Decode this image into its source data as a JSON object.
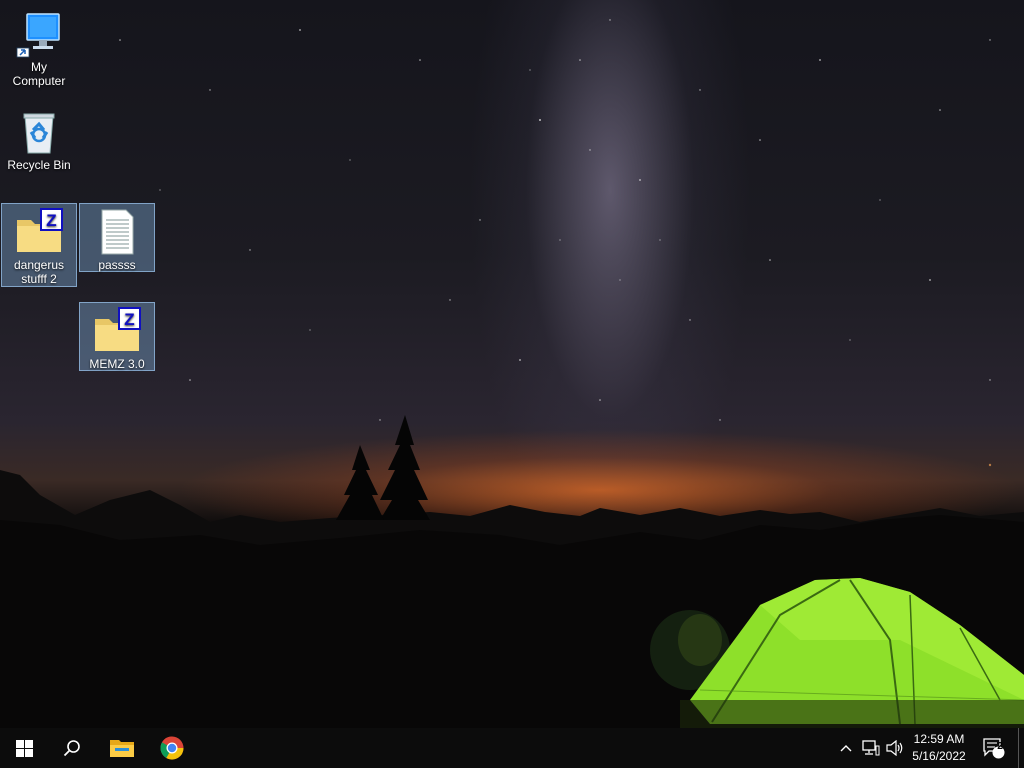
{
  "desktop": {
    "icons": [
      {
        "id": "my-computer",
        "label": "My Computer",
        "icon": "computer-icon",
        "selected": false
      },
      {
        "id": "recycle-bin",
        "label": "Recycle Bin",
        "icon": "recycle-bin-icon",
        "selected": false
      },
      {
        "id": "dangerus",
        "label": "dangerus stufff 2",
        "icon": "zip-folder-icon",
        "selected": true
      },
      {
        "id": "passss",
        "label": "passss",
        "icon": "text-document-icon",
        "selected": true
      },
      {
        "id": "memz",
        "label": "MEMZ 3.0",
        "icon": "zip-folder-icon",
        "selected": true
      }
    ]
  },
  "taskbar": {
    "start": "windows-start-icon",
    "search": "search-icon",
    "pinned": [
      {
        "name": "file-explorer",
        "icon": "file-explorer-icon"
      },
      {
        "name": "chrome",
        "icon": "chrome-icon"
      }
    ],
    "tray": {
      "chevron": "chevron-up-icon",
      "network": "network-icon",
      "volume": "volume-icon",
      "time": "12:59 AM",
      "date": "5/16/2022",
      "notifications_count": "2"
    }
  },
  "colors": {
    "taskbar_bg": "#0c0c0c",
    "selection_bg": "#78a0c8",
    "tent_green": "#8ee02a"
  }
}
